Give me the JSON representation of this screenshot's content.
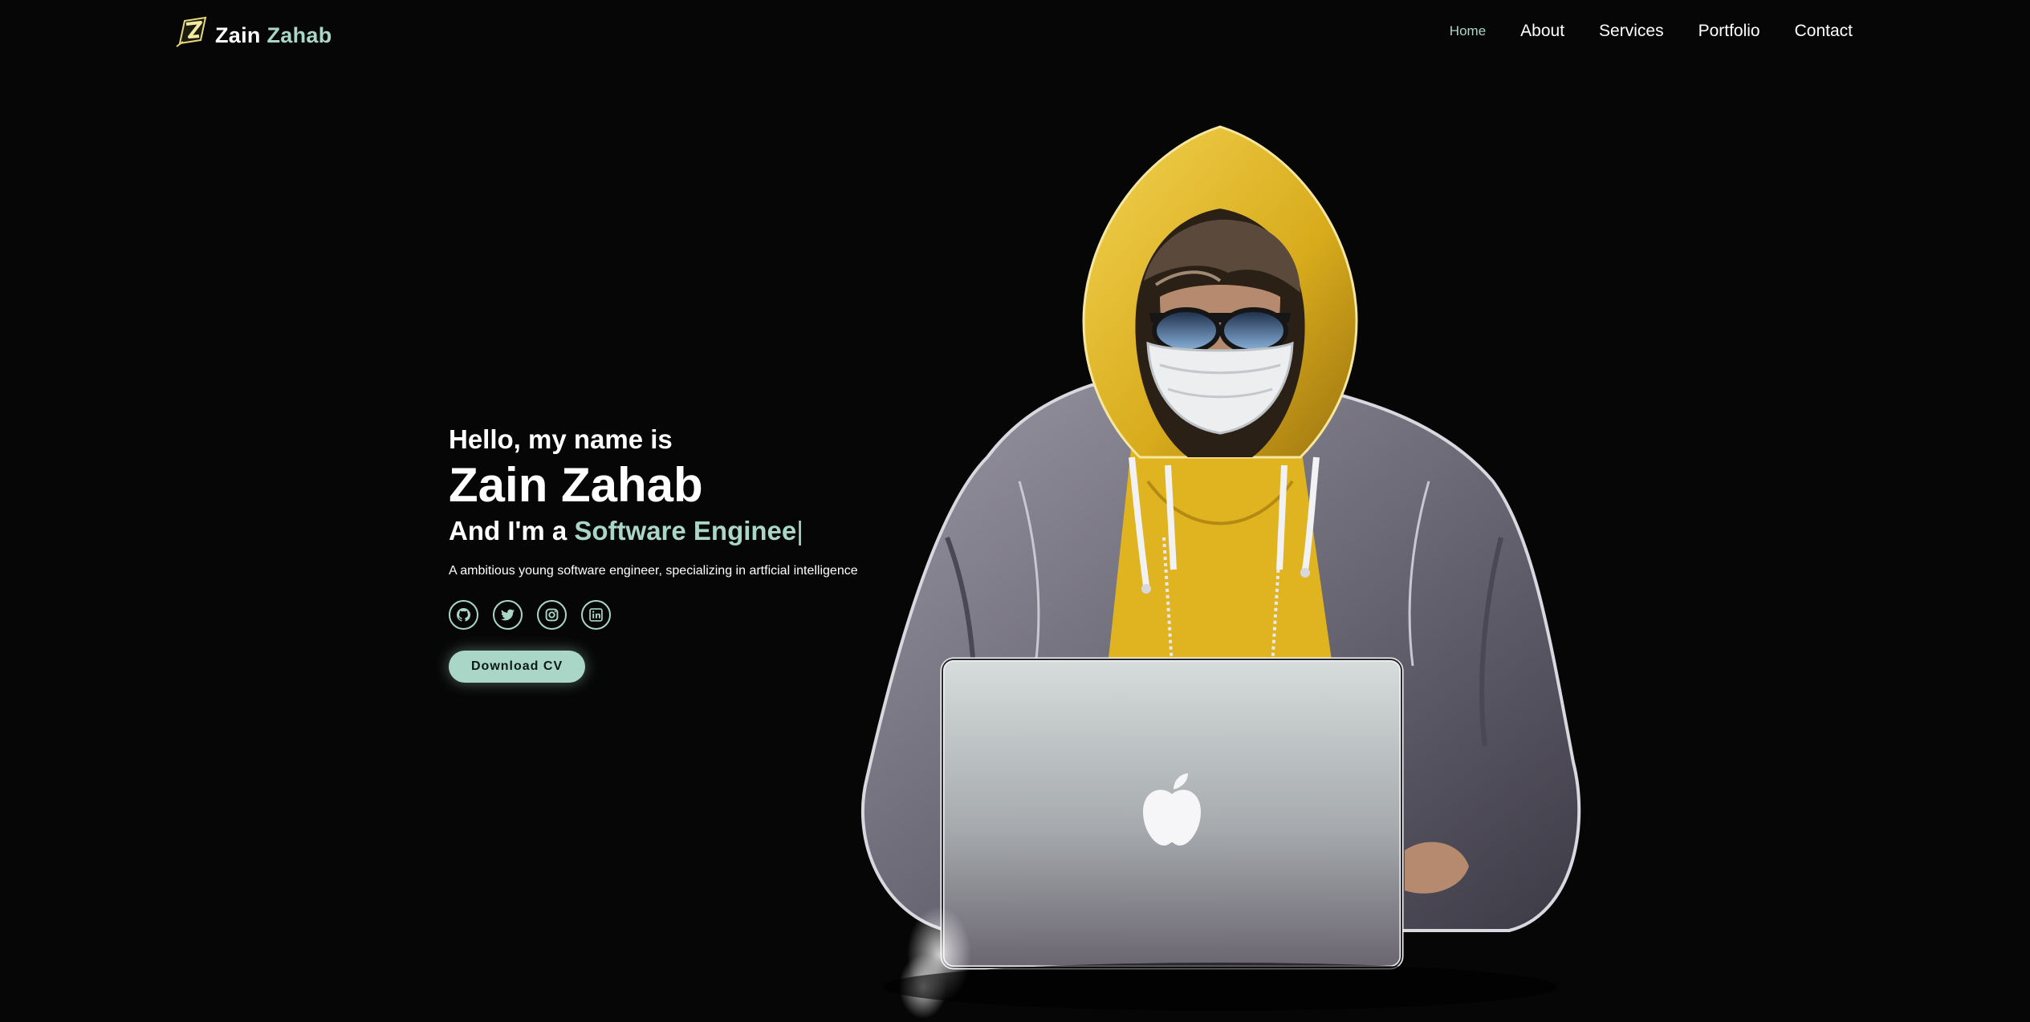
{
  "brand": {
    "first": "Zain",
    "last": "Zahab",
    "logo_icon": "z-lightning-logo-icon"
  },
  "nav": {
    "items": [
      {
        "label": "Home",
        "active": true
      },
      {
        "label": "About",
        "active": false
      },
      {
        "label": "Services",
        "active": false
      },
      {
        "label": "Portfolio",
        "active": false
      },
      {
        "label": "Contact",
        "active": false
      }
    ]
  },
  "hero": {
    "greeting": "Hello, my name is",
    "name": "Zain Zahab",
    "role_prefix": "And I'm a ",
    "role_typed": "Software Enginee",
    "cursor": "|",
    "tagline": "A ambitious young software engineer, specializing in artficial intelligence",
    "socials": [
      {
        "icon": "github-icon"
      },
      {
        "icon": "twitter-icon"
      },
      {
        "icon": "instagram-icon"
      },
      {
        "icon": "linkedin-icon"
      }
    ],
    "cv_button": "Download CV",
    "illustration": "hooded-hacker-with-laptop-illustration"
  },
  "colors": {
    "background": "#060606",
    "accent": "#a9d6c7",
    "text": "#ffffff"
  }
}
